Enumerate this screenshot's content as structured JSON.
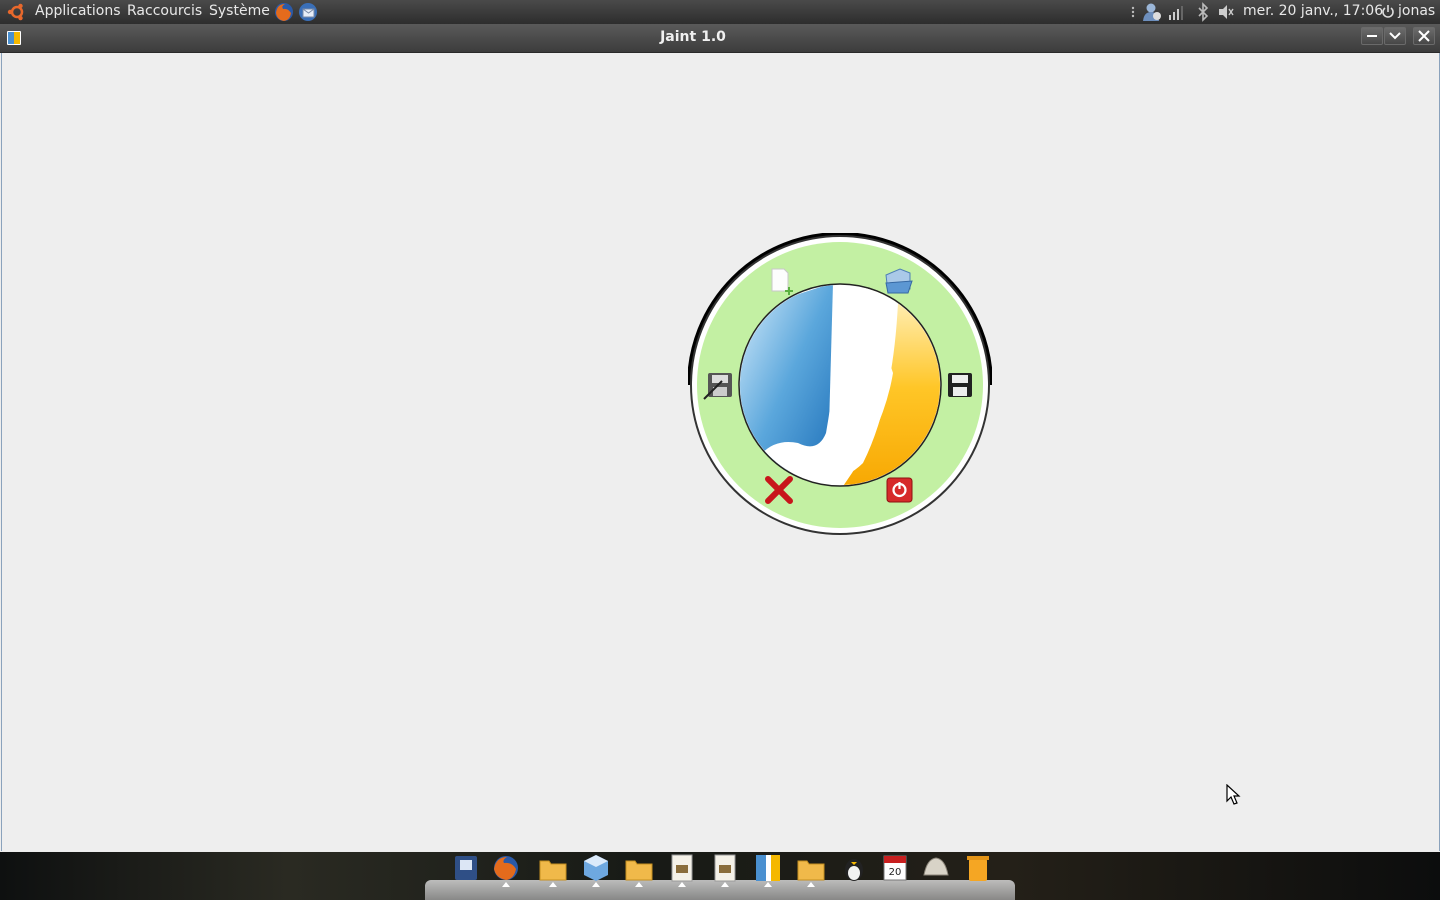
{
  "top_panel": {
    "menus": [
      "Applications",
      "Raccourcis",
      "Système"
    ],
    "launchers": [
      "firefox-icon",
      "thunderbird-icon"
    ],
    "tray_icons": [
      "messaging-icon",
      "network-signal-icon",
      "bluetooth-icon",
      "volume-icon"
    ],
    "clock": "mer. 20 janv., 17:06",
    "user": "jonas"
  },
  "window": {
    "title": "Jaint 1.0",
    "controls": [
      "minimize",
      "maximize",
      "close"
    ]
  },
  "radial_menu": {
    "center_logo": "J",
    "items": [
      "new-file",
      "open-folder",
      "save-as",
      "save",
      "cancel",
      "quit"
    ],
    "colors": {
      "ring": "#c3f0a3",
      "outline": "#000000"
    }
  },
  "dock": {
    "icons": [
      "file-manager-icon",
      "firefox-icon",
      "folder-icon",
      "3d-cube-icon",
      "folder-icon",
      "document-icon",
      "document-icon",
      "jaint-icon",
      "folder-icon",
      "tux-icon",
      "calendar-icon",
      "shell-icon",
      "trash-icon"
    ]
  }
}
